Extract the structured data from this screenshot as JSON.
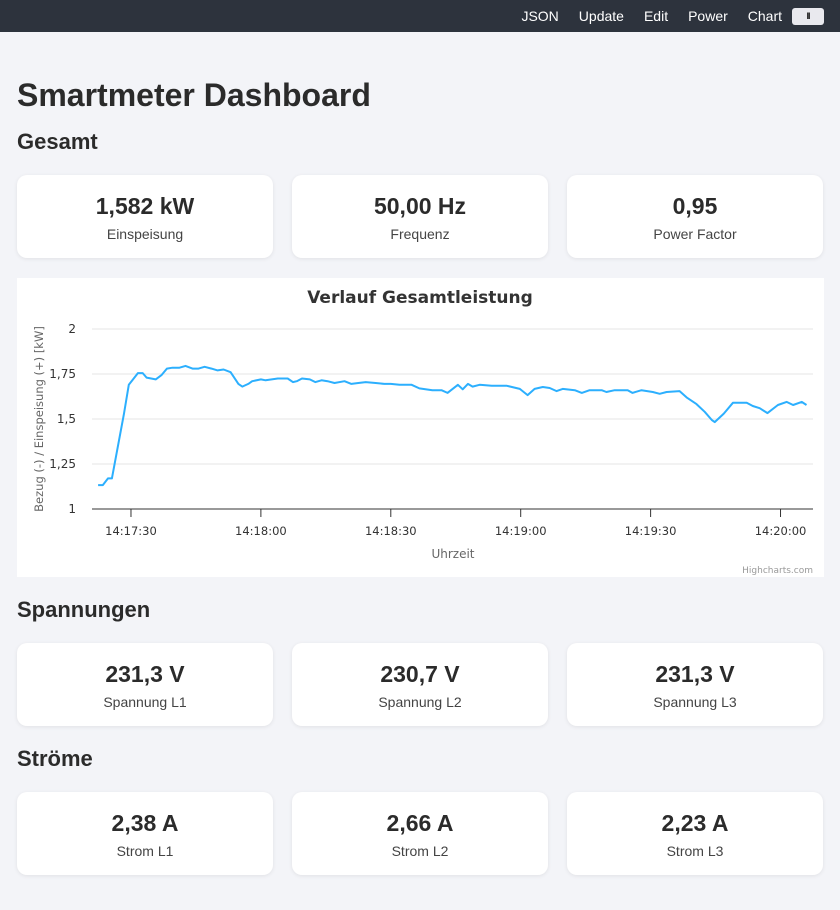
{
  "nav": {
    "items": [
      "JSON",
      "Update",
      "Edit",
      "Power",
      "Chart"
    ],
    "pause_label": "II"
  },
  "page_title": "Smartmeter Dashboard",
  "sections": {
    "gesamt": {
      "title": "Gesamt",
      "cards": [
        {
          "value": "1,582 kW",
          "label": "Einspeisung"
        },
        {
          "value": "50,00 Hz",
          "label": "Frequenz"
        },
        {
          "value": "0,95",
          "label": "Power Factor"
        }
      ]
    },
    "spannungen": {
      "title": "Spannungen",
      "cards": [
        {
          "value": "231,3 V",
          "label": "Spannung L1"
        },
        {
          "value": "230,7 V",
          "label": "Spannung L2"
        },
        {
          "value": "231,3 V",
          "label": "Spannung L3"
        }
      ]
    },
    "stroeme": {
      "title": "Ströme",
      "cards": [
        {
          "value": "2,38 A",
          "label": "Strom L1"
        },
        {
          "value": "2,66 A",
          "label": "Strom L2"
        },
        {
          "value": "2,23 A",
          "label": "Strom L3"
        }
      ]
    }
  },
  "chart_data": {
    "type": "line",
    "title": "Verlauf Gesamtleistung",
    "xlabel": "Uhrzeit",
    "ylabel": "Bezug (-) / Einspeisung (+) [kW]",
    "credits": "Highcharts.com",
    "xlim": [
      "14:17:21",
      "14:20:07.5"
    ],
    "ylim": [
      1,
      2
    ],
    "yticks": [
      "1",
      "1,25",
      "1,5",
      "1,75",
      "2"
    ],
    "xticks": [
      "14:17:30",
      "14:18:00",
      "14:18:30",
      "14:19:00",
      "14:19:30",
      "14:20:00"
    ],
    "grid": true,
    "color": "#2caffe",
    "x": [
      "14:17:22.4",
      "14:17:23.5",
      "14:17:24.7",
      "14:17:25.6",
      "14:17:28.4",
      "14:17:29.5",
      "14:17:31.6",
      "14:17:32.7",
      "14:17:33.6",
      "14:17:35.7",
      "14:17:37.1",
      "14:17:38.3",
      "14:17:39.6",
      "14:17:41.2",
      "14:17:42.6",
      "14:17:44.2",
      "14:17:45.6",
      "14:17:47.0",
      "14:17:48.6",
      "14:17:50.0",
      "14:17:51.4",
      "14:17:53.0",
      "14:17:54.8",
      "14:17:55.7",
      "14:17:57.1",
      "14:17:58.0",
      "14:18:00.0",
      "14:18:01.1",
      "14:18:02.5",
      "14:18:03.9",
      "14:18:06.2",
      "14:18:07.4",
      "14:18:08.3",
      "14:18:09.5",
      "14:18:11.3",
      "14:18:12.6",
      "14:18:14.0",
      "14:18:15.4",
      "14:18:17.0",
      "14:18:19.3",
      "14:18:20.9",
      "14:18:22.5",
      "14:18:24.2",
      "14:18:26.5",
      "14:18:28.5",
      "14:18:30.0",
      "14:18:32.0",
      "14:18:34.8",
      "14:18:36.6",
      "14:18:39.6",
      "14:18:41.7",
      "14:18:43.1",
      "14:18:45.5",
      "14:18:46.6",
      "14:18:47.8",
      "14:18:48.9",
      "14:18:50.5",
      "14:18:53.3",
      "14:18:56.7",
      "14:18:59.8",
      "14:19:01.6",
      "14:19:03.2",
      "14:19:05.1",
      "14:19:06.7",
      "14:19:08.3",
      "14:19:09.7",
      "14:19:12.5",
      "14:19:14.1",
      "14:19:15.9",
      "14:19:18.7",
      "14:19:19.8",
      "14:19:21.7",
      "14:19:24.7",
      "14:19:25.8",
      "14:19:27.9",
      "14:19:30.5",
      "14:19:32.1",
      "14:19:33.7",
      "14:19:36.7",
      "14:19:38.3",
      "14:19:40.6",
      "14:19:42.5",
      "14:19:44.1",
      "14:19:44.8",
      "14:19:46.9",
      "14:19:49.0",
      "14:19:52.2",
      "14:19:53.6",
      "14:19:55.2",
      "14:19:57.0",
      "14:19:59.4",
      "14:20:01.4",
      "14:20:02.9",
      "14:20:04.9",
      "14:20:06.0"
    ],
    "values": [
      1.133,
      1.133,
      1.17,
      1.17,
      1.53,
      1.69,
      1.755,
      1.755,
      1.73,
      1.72,
      1.745,
      1.78,
      1.785,
      1.785,
      1.795,
      1.78,
      1.78,
      1.79,
      1.78,
      1.77,
      1.775,
      1.76,
      1.695,
      1.68,
      1.695,
      1.71,
      1.72,
      1.715,
      1.72,
      1.725,
      1.725,
      1.705,
      1.71,
      1.725,
      1.72,
      1.705,
      1.715,
      1.71,
      1.7,
      1.71,
      1.695,
      1.7,
      1.705,
      1.7,
      1.695,
      1.695,
      1.69,
      1.69,
      1.67,
      1.66,
      1.66,
      1.645,
      1.69,
      1.665,
      1.695,
      1.68,
      1.69,
      1.685,
      1.685,
      1.667,
      1.633,
      1.667,
      1.678,
      1.672,
      1.655,
      1.667,
      1.66,
      1.645,
      1.66,
      1.66,
      1.65,
      1.66,
      1.66,
      1.645,
      1.66,
      1.65,
      1.64,
      1.65,
      1.655,
      1.62,
      1.583,
      1.54,
      1.495,
      1.483,
      1.53,
      1.59,
      1.59,
      1.572,
      1.56,
      1.533,
      1.578,
      1.595,
      1.578,
      1.595,
      1.578
    ]
  }
}
